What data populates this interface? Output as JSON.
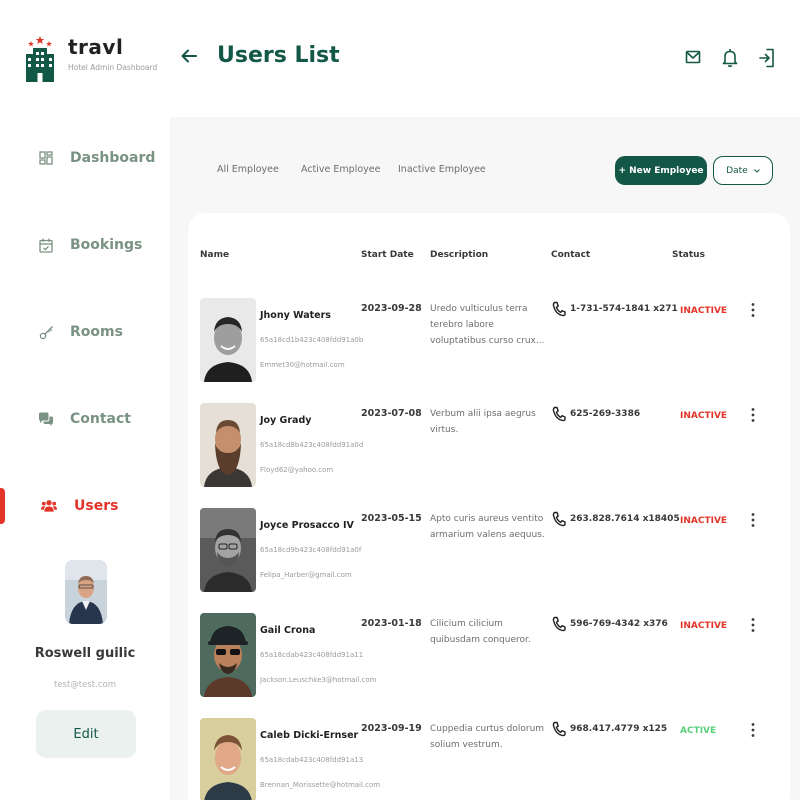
{
  "brand": {
    "name": "travl",
    "subtitle": "Hotel Admin Dashboard",
    "logo_icon": "hotel-icon"
  },
  "nav": [
    {
      "label": "Dashboard",
      "icon": "dashboard-icon"
    },
    {
      "label": "Bookings",
      "icon": "calendar-icon"
    },
    {
      "label": "Rooms",
      "icon": "key-icon"
    },
    {
      "label": "Contact",
      "icon": "chat-icon"
    },
    {
      "label": "Users",
      "icon": "users-icon",
      "active": true
    }
  ],
  "profile": {
    "name": "Roswell guilic",
    "email": "test@test.com",
    "edit_label": "Edit"
  },
  "header": {
    "title": "Users List",
    "icons": [
      "back-arrow-icon",
      "mail-icon",
      "bell-icon",
      "logout-icon"
    ]
  },
  "tabs": [
    "All Employee",
    "Active Employee",
    "Inactive Employee"
  ],
  "actions": {
    "new_label": "+ New Employee",
    "date_label": "Date"
  },
  "table": {
    "columns": [
      "Name",
      "Start Date",
      "Description",
      "Contact",
      "Status"
    ],
    "rows": [
      {
        "name": "Jhony Waters",
        "id": "65a18cd1b423c408fdd91a0b",
        "email": "Emmet30@hotmail.com",
        "start": "2023-09-28",
        "description": "Uredo vulticulus terra terebro labore voluptatibus curso crux...",
        "contact": "1-731-574-1841 x271",
        "status": "INACTIVE"
      },
      {
        "name": "Joy Grady",
        "id": "65a18cd8b423c408fdd91a0d",
        "email": "Floyd62@yahoo.com",
        "start": "2023-07-08",
        "description": "Verbum alii ipsa aegrus virtus.",
        "contact": "625-269-3386",
        "status": "INACTIVE"
      },
      {
        "name": "Joyce Prosacco IV",
        "id": "65a18cd9b423c408fdd91a0f",
        "email": "Felipa_Harber@gmail.com",
        "start": "2023-05-15",
        "description": "Apto curis aureus ventito armarium valens aequus.",
        "contact": "263.828.7614 x18405",
        "status": "INACTIVE"
      },
      {
        "name": "Gail Crona",
        "id": "65a18cdab423c408fdd91a11",
        "email": "Jackson.Leuschke3@hotmail.com",
        "start": "2023-01-18",
        "description": "Cilicium cilicium quibusdam conqueror.",
        "contact": "596-769-4342 x376",
        "status": "INACTIVE"
      },
      {
        "name": "Caleb Dicki-Ernser",
        "id": "65a18cdab423c408fdd91a13",
        "email": "Brennan_Morissette@hotmail.com",
        "start": "2023-09-19",
        "description": "Cuppedia curtus dolorum solium vestrum.",
        "contact": "968.417.4779 x125",
        "status": "ACTIVE"
      }
    ]
  },
  "colors": {
    "brand_green": "#135846",
    "active_red": "#e23428",
    "inactive": "#e23428",
    "active": "#5ad07a",
    "nav_text": "#799283"
  }
}
